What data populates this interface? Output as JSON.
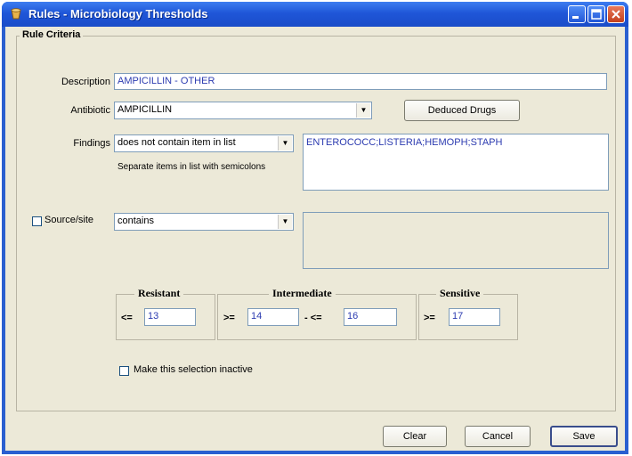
{
  "window": {
    "title": "Rules - Microbiology Thresholds"
  },
  "criteria": {
    "legend": "Rule Criteria",
    "description": {
      "label": "Description",
      "value": "AMPICILLIN - OTHER"
    },
    "antibiotic": {
      "label": "Antibiotic",
      "value": "AMPICILLIN",
      "deduced_button": "Deduced Drugs"
    },
    "findings": {
      "label": "Findings",
      "operator": "does not contain item in list",
      "hint": "Separate items in list with semicolons",
      "items": "ENTEROCOCC;LISTERIA;HEMOPH;STAPH"
    },
    "source": {
      "label": "Source/site",
      "operator": "contains",
      "items": ""
    },
    "resistant": {
      "legend": "Resistant",
      "op": "<=",
      "value": "13"
    },
    "intermediate": {
      "legend": "Intermediate",
      "op1": ">=",
      "value1": "14",
      "op2": "- <=",
      "value2": "16"
    },
    "sensitive": {
      "legend": "Sensitive",
      "op": ">=",
      "value": "17"
    },
    "inactive_label": "Make this selection inactive"
  },
  "buttons": {
    "clear": "Clear",
    "cancel": "Cancel",
    "save": "Save"
  },
  "colors": {
    "title_bar": "#1f56d8",
    "client_bg": "#ece9d8",
    "value_text": "#2c3bb0"
  }
}
